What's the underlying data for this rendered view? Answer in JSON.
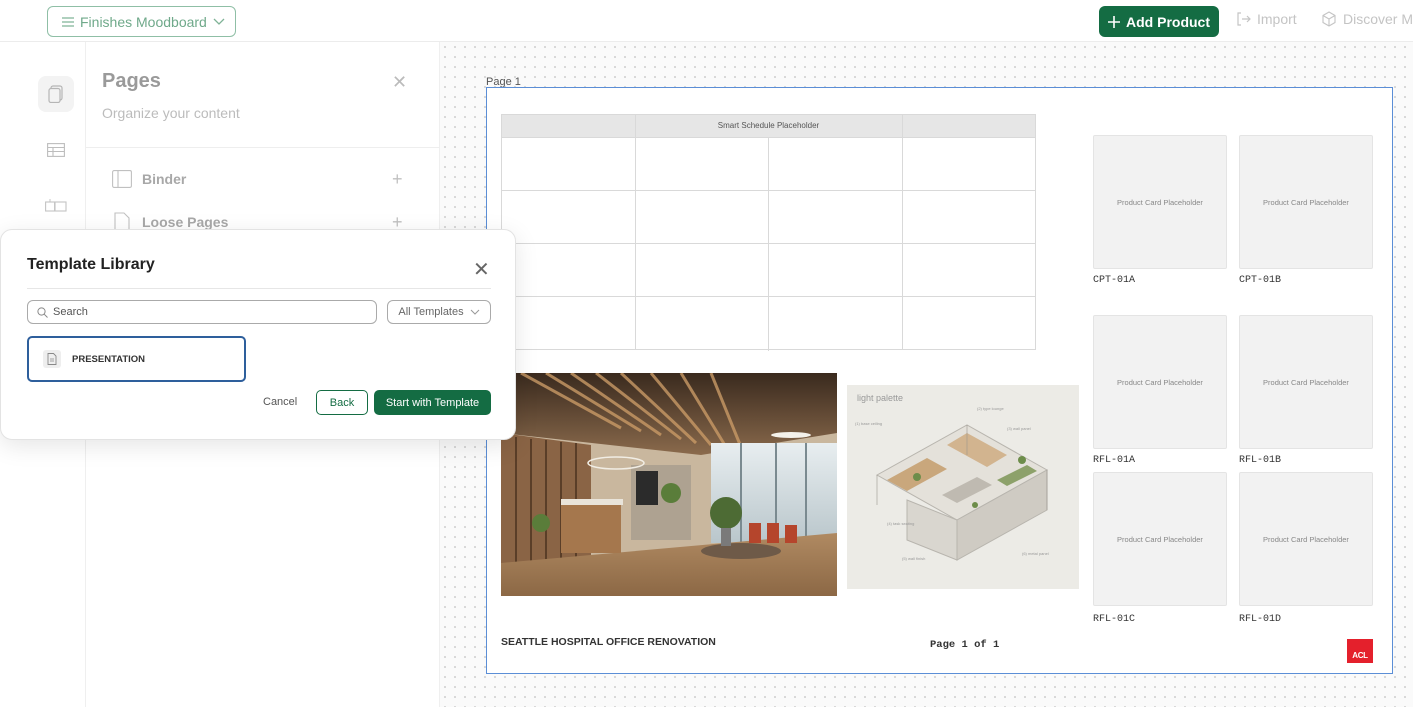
{
  "topbar": {
    "board_name": "Finishes Moodboard",
    "add_product": "Add Product",
    "import": "Import",
    "discover": "Discover M"
  },
  "pages_panel": {
    "title": "Pages",
    "subtitle": "Organize your content",
    "items": [
      {
        "label": "Binder"
      },
      {
        "label": "Loose Pages"
      }
    ]
  },
  "canvas": {
    "page_label": "Page 1",
    "schedule_placeholder": "Smart Schedule Placeholder",
    "plan_label": "light palette",
    "product_cards": [
      {
        "placeholder": "Product Card Placeholder",
        "code": "CPT-01A"
      },
      {
        "placeholder": "Product Card Placeholder",
        "code": "CPT-01B"
      },
      {
        "placeholder": "Product Card Placeholder",
        "code": "RFL-01A"
      },
      {
        "placeholder": "Product Card Placeholder",
        "code": "RFL-01B"
      },
      {
        "placeholder": "Product Card Placeholder",
        "code": "RFL-01C"
      },
      {
        "placeholder": "Product Card Placeholder",
        "code": "RFL-01D"
      }
    ],
    "project_title": "SEATTLE HOSPITAL OFFICE RENOVATION",
    "page_footer": "Page 1 of 1",
    "logo_text": "ACL"
  },
  "modal": {
    "title": "Template Library",
    "search_placeholder": "Search",
    "filter_selected": "All Templates",
    "templates": [
      {
        "label": "PRESENTATION"
      }
    ],
    "cancel": "Cancel",
    "back": "Back",
    "start": "Start with Template"
  },
  "colors": {
    "brand_green": "#146c43",
    "selection_blue": "#2e5f9c",
    "page_border": "#5b8ed6",
    "logo_red": "#e4202c"
  }
}
